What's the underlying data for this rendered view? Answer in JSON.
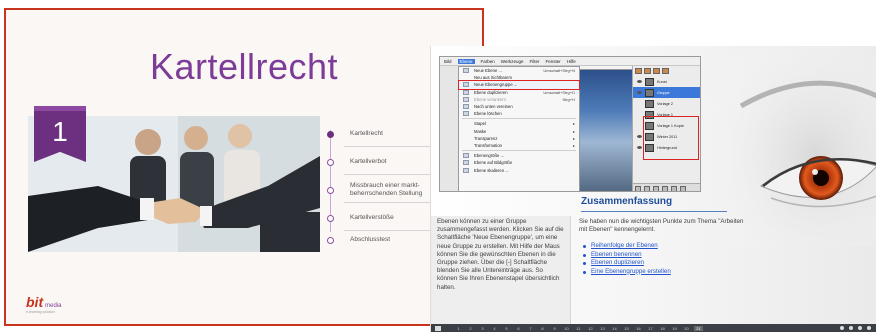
{
  "left_slide": {
    "title": "Kartellrecht",
    "chapter_number": "1",
    "agenda": [
      {
        "label": "Kartellrecht",
        "active": true
      },
      {
        "label": "Kartellverbot",
        "active": false
      },
      {
        "label": "Missbrauch einer markt-\nbeherrschenden Stellung",
        "active": false
      },
      {
        "label": "Kartellverstöße",
        "active": false
      },
      {
        "label": "Abschlusstest",
        "active": false
      }
    ],
    "logo": {
      "bit": "bit",
      "media": "media",
      "sub": "e-learning solution"
    },
    "accent_color": "#7c3c98",
    "border_color": "#c8341e"
  },
  "right_slide": {
    "gimp": {
      "menu": [
        "Bild",
        "Ebene",
        "Farben",
        "Werkzeuge",
        "Filter",
        "Fenster",
        "Hilfe"
      ],
      "active_menu": "Ebene",
      "items": [
        {
          "label": "Neue Ebene ...",
          "shortcut": "Umschalt+Strg+N",
          "dim": false,
          "highlight": false
        },
        {
          "label": "Neu aus Sichtbarem",
          "shortcut": "",
          "dim": false,
          "highlight": false
        },
        {
          "label": "Neue Ebenengruppe ...",
          "shortcut": "",
          "dim": false,
          "highlight": true
        },
        {
          "label": "Ebene duplizieren",
          "shortcut": "Umschalt+Strg+D",
          "dim": false,
          "highlight": false
        },
        {
          "label": "Ebene verankern",
          "shortcut": "Strg+H",
          "dim": true,
          "highlight": false
        },
        {
          "label": "Nach unten vereinen",
          "shortcut": "",
          "dim": false,
          "highlight": false
        },
        {
          "label": "Ebene löschen",
          "shortcut": "",
          "dim": false,
          "highlight": false
        },
        {
          "label": "Stapel",
          "shortcut": "",
          "dim": false,
          "highlight": false,
          "submenu": true
        },
        {
          "label": "Maske",
          "shortcut": "",
          "dim": false,
          "highlight": false,
          "submenu": true
        },
        {
          "label": "Transparenz",
          "shortcut": "",
          "dim": false,
          "highlight": false,
          "submenu": true
        },
        {
          "label": "Transformation",
          "shortcut": "",
          "dim": false,
          "highlight": false,
          "submenu": true
        },
        {
          "label": "Ebenengröße ...",
          "shortcut": "",
          "dim": false,
          "highlight": false
        },
        {
          "label": "Ebene auf Bildgröße",
          "shortcut": "",
          "dim": false,
          "highlight": false
        },
        {
          "label": "Ebene skalieren ...",
          "shortcut": "",
          "dim": false,
          "highlight": false
        }
      ],
      "layers": [
        {
          "name": "Kunst",
          "selected": false,
          "sub": false
        },
        {
          "name": "Gruppe",
          "selected": true,
          "sub": false
        },
        {
          "name": "Vorlage 2",
          "selected": false,
          "sub": true
        },
        {
          "name": "Vorlage 1",
          "selected": false,
          "sub": true
        },
        {
          "name": "Vorlage 1 Kopie",
          "selected": false,
          "sub": true
        },
        {
          "name": "Winter 2011",
          "selected": false,
          "sub": false
        },
        {
          "name": "Hintergrund",
          "selected": false,
          "sub": false
        }
      ]
    },
    "heading": "Zusammenfassung",
    "left_text": "Ebenen können zu einer Gruppe zusammengefasst werden. Klicken Sie auf die Schaltfläche 'Neue Ebenengruppe', um eine neue Gruppe zu erstellen. Mit Hilfe der Maus können Sie die gewünschten Ebenen in die Gruppe ziehen. Über die [-] Schaltfläche blenden Sie alle Untereinträge aus. So können Sie Ihren Ebenenstapel übersichtlich halten.",
    "right_text": "Sie haben nun die wichtigsten Punkte zum Thema \"Arbeiten mit Ebenen\" kennengelernt.",
    "links": [
      "Reihenfolge der Ebenen",
      "Ebenen benennen",
      "Ebenen duplizieren",
      "Eine Ebenengruppe erstellen"
    ],
    "nav_pages": [
      "1",
      "2",
      "3",
      "4",
      "5",
      "6",
      "7",
      "8",
      "9",
      "10",
      "11",
      "12",
      "13",
      "14",
      "15",
      "16",
      "17",
      "18",
      "19",
      "20",
      "21"
    ],
    "current_page": "21",
    "heading_color": "#1f4e9b",
    "link_color": "#2255cc"
  }
}
